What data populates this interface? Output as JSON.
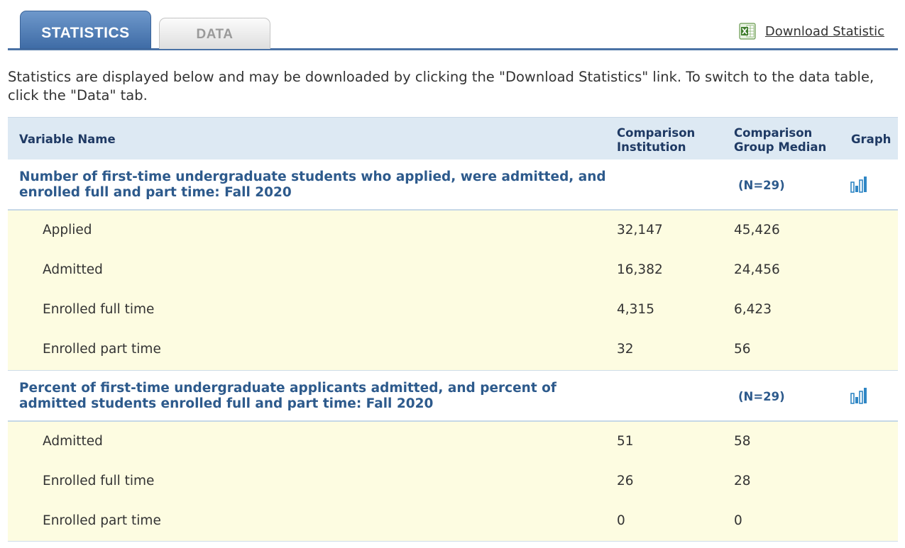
{
  "tabs": {
    "statistics": "STATISTICS",
    "data": "DATA"
  },
  "download": {
    "label": "Download Statistic",
    "icon": "excel-icon"
  },
  "intro": "Statistics are displayed below and may be downloaded by clicking the \"Download Statistics\" link. To switch to the data table, click the \"Data\" tab.",
  "table": {
    "headers": {
      "variable": "Variable Name",
      "comparison_institution": [
        "Comparison",
        "Institution"
      ],
      "group_median": [
        "Comparison",
        "Group Median"
      ],
      "graph": "Graph"
    },
    "groups": [
      {
        "title": "Number of first-time undergraduate students who applied, were admitted, and enrolled full and part time: Fall 2020",
        "n": "(N=29)",
        "graph_icon": "bar-chart-icon",
        "rows": [
          {
            "label": "Applied",
            "institution": "32,147",
            "median": "45,426"
          },
          {
            "label": "Admitted",
            "institution": "16,382",
            "median": "24,456"
          },
          {
            "label": "Enrolled full time",
            "institution": "4,315",
            "median": "6,423"
          },
          {
            "label": "Enrolled part time",
            "institution": "32",
            "median": "56"
          }
        ]
      },
      {
        "title": "Percent of first-time undergraduate applicants admitted, and percent of admitted students enrolled full and part time: Fall 2020",
        "n": "(N=29)",
        "graph_icon": "bar-chart-icon",
        "rows": [
          {
            "label": "Admitted",
            "institution": "51",
            "median": "58"
          },
          {
            "label": "Enrolled full time",
            "institution": "26",
            "median": "28"
          },
          {
            "label": "Enrolled part time",
            "institution": "0",
            "median": "0"
          }
        ]
      }
    ]
  },
  "colors": {
    "accent_blue": "#4a72a5",
    "header_bg": "#dde9f3",
    "row_bg": "#fdfce1",
    "group_title": "#2d5a8c",
    "graph_icon": "#2f86c4"
  }
}
